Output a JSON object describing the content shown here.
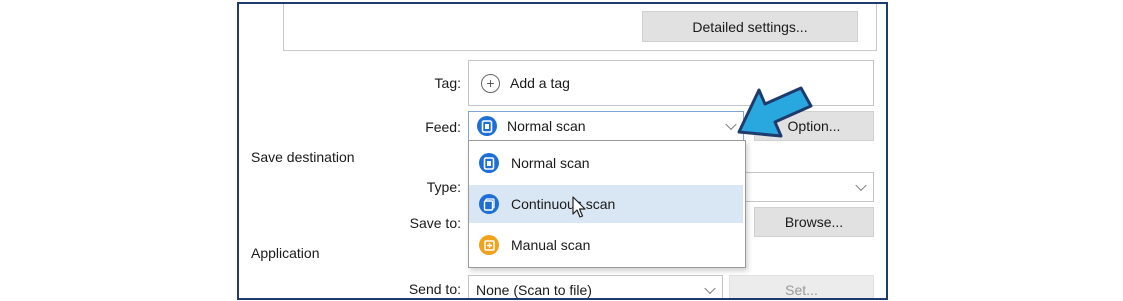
{
  "detailed_settings_label": "Detailed settings...",
  "tag": {
    "label": "Tag:",
    "add_label": "Add a tag"
  },
  "feed": {
    "label": "Feed:",
    "selected": "Normal scan",
    "option_button": "Option..."
  },
  "save_destination": {
    "heading": "Save destination",
    "type_label": "Type:",
    "save_to_label": "Save to:",
    "browse_button": "Browse..."
  },
  "application": {
    "heading": "Application",
    "send_to_label": "Send to:",
    "send_to_value": "None (Scan to file)",
    "set_button": "Set..."
  },
  "feed_options": [
    {
      "label": "Normal scan",
      "icon": "normal-scan-icon"
    },
    {
      "label": "Continuous scan",
      "icon": "continuous-scan-icon"
    },
    {
      "label": "Manual scan",
      "icon": "manual-scan-icon"
    }
  ],
  "colors": {
    "frame_border": "#1f3b6e",
    "arrow_fill": "#29a8e0",
    "arrow_outline": "#1f3b6e",
    "hover": "#d9e6f3",
    "scan_icon_blue": "#1d6fd6",
    "scan_icon_orange": "#f0a21c"
  }
}
